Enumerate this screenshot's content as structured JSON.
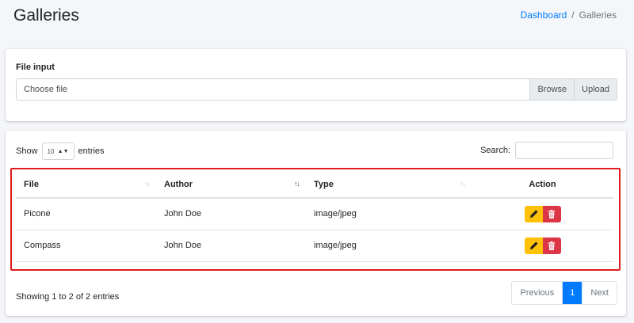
{
  "header": {
    "title": "Galleries",
    "breadcrumb": {
      "link": "Dashboard",
      "separator": "/",
      "current": "Galleries"
    }
  },
  "upload": {
    "label": "File input",
    "placeholder": "Choose file",
    "browse_label": "Browse",
    "upload_label": "Upload"
  },
  "table": {
    "show_label": "Show",
    "entries_label": "entries",
    "page_length": "10",
    "search_label": "Search:",
    "columns": [
      "File",
      "Author",
      "Type",
      "Action"
    ],
    "rows": [
      {
        "file": "Picone",
        "author": "John Doe",
        "type": "image/jpeg"
      },
      {
        "file": "Compass",
        "author": "John Doe",
        "type": "image/jpeg"
      }
    ],
    "info": "Showing 1 to 2 of 2 entries",
    "pagination": {
      "previous": "Previous",
      "current_page": "1",
      "next": "Next"
    }
  },
  "icons": {
    "edit": "pencil-icon",
    "delete": "trash-icon",
    "sort": "sort-icon"
  },
  "colors": {
    "accent": "#007bff",
    "edit_button": "#ffc107",
    "delete_button": "#dc3545",
    "highlight_border": "#e01b1b"
  }
}
